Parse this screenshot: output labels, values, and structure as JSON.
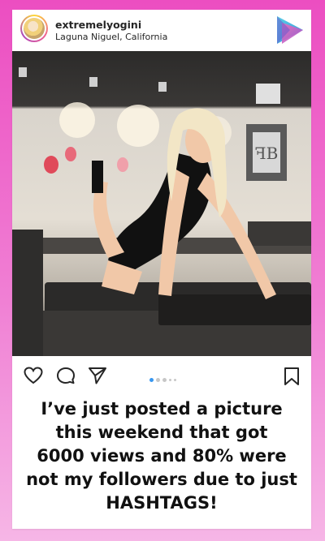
{
  "post": {
    "username": "extremelyogini",
    "location": "Laguna Niguel, California",
    "carousel": {
      "count": 5,
      "active_index": 0
    }
  },
  "icons": {
    "like": "heart-icon",
    "comment": "comment-icon",
    "share": "send-icon",
    "save": "bookmark-icon",
    "brand": "play-logo-icon"
  },
  "caption": {
    "lines": [
      "I’ve just posted a picture",
      "this weekend that got",
      "6000 views and 80% were",
      "not my followers due to just",
      "HASHTAGS!"
    ]
  },
  "colors": {
    "background_top": "#ec4ec1",
    "background_bottom": "#f6b6e6",
    "carousel_active": "#3897f0",
    "text": "#262626"
  }
}
